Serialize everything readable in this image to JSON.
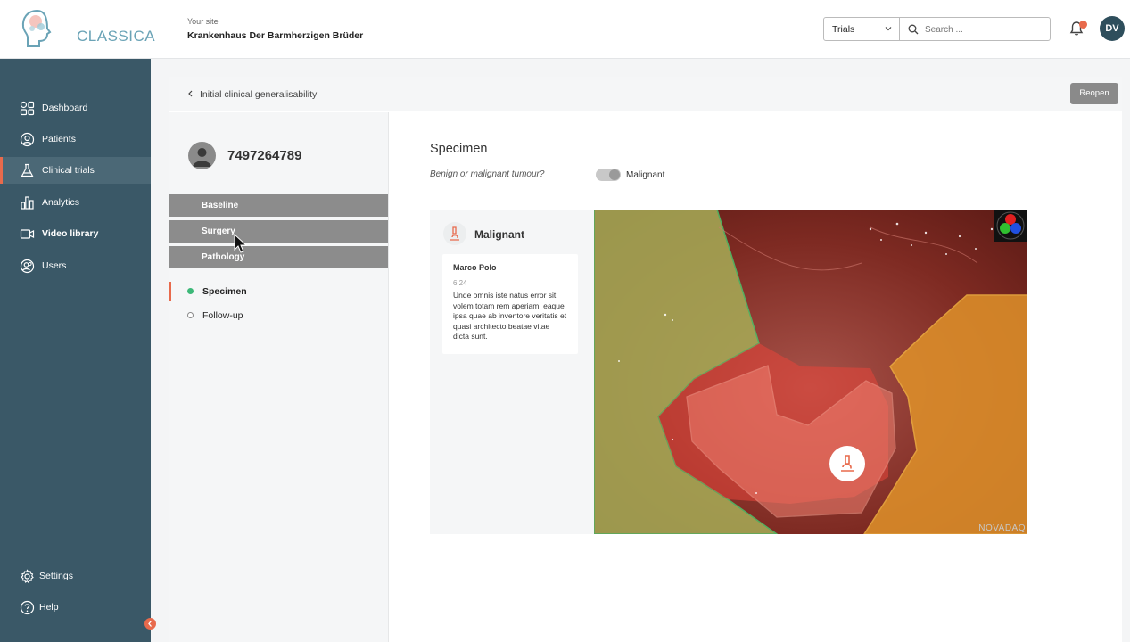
{
  "app": {
    "name": "CLASSICA",
    "site_label": "Your site",
    "site_name": "Krankenhaus Der Barmherzigen Brüder"
  },
  "header": {
    "select_value": "Trials",
    "search_placeholder": "Search ...",
    "user_initials": "DV"
  },
  "sidebar": {
    "items": [
      {
        "label": "Dashboard",
        "icon": "dashboard-icon"
      },
      {
        "label": "Patients",
        "icon": "user-circle-icon"
      },
      {
        "label": "Clinical trials",
        "icon": "flask-icon"
      },
      {
        "label": "Analytics",
        "icon": "bar-chart-icon"
      },
      {
        "label": "Video library",
        "icon": "video-icon"
      },
      {
        "label": "Users",
        "icon": "users-icon"
      }
    ],
    "bottom": [
      {
        "label": "Settings",
        "icon": "gear-icon"
      },
      {
        "label": "Help",
        "icon": "help-icon"
      }
    ]
  },
  "breadcrumb": {
    "text": "Initial clinical generalisability",
    "reopen_label": "Reopen"
  },
  "patient": {
    "id": "7497264789"
  },
  "sections": [
    "Baseline",
    "Surgery",
    "Pathology"
  ],
  "steps": [
    {
      "label": "Specimen",
      "status": "active"
    },
    {
      "label": "Follow-up",
      "status": "pending"
    }
  ],
  "specimen": {
    "title": "Specimen",
    "question": "Benign or malignant tumour?",
    "toggle_label": "Malignant"
  },
  "comments": {
    "title": "Malignant",
    "author": "Marco Polo",
    "time": "6:24",
    "text": "Unde omnis iste natus error sit volem totam rem aperiam, eaque ipsa quae ab inventore veritatis et quasi architecto beatae vitae dicta sunt."
  },
  "image": {
    "watermark": "NOVADAQ"
  },
  "colors": {
    "sidebar": "#3a5867",
    "accent": "#e86a4c",
    "green_region": "#9aa05a",
    "red_region": "#b83a2e",
    "orange_region": "#e59a2a"
  }
}
